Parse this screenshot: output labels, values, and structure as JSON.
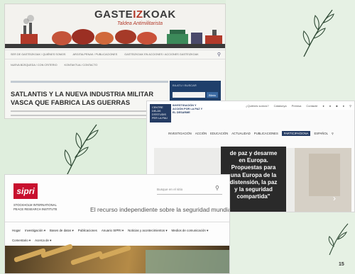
{
  "slide": {
    "page_number": "15",
    "colors": {
      "background": "#dfeedd",
      "leaf": "#2f4a35"
    },
    "decorations": [
      "leaf-icon",
      "leaf-icon",
      "leaf-icon"
    ]
  },
  "shot1": {
    "logo_part1": "GASTE",
    "logo_part2": "IZ",
    "logo_part3": "KOAK",
    "subtitle": "Taldea Antimilitarista",
    "nav_row1": [
      "Ser de Gasteizkoak / Quiénes somos",
      "Argitalpenak / Publicaciones",
      "Gasteizkoak en Acciones / Acciones Gasteizkoak"
    ],
    "nav_row2": [
      "Nueva búsqueda / Con criterio",
      "Kontaktua / Contacto"
    ],
    "title": "SATLANTIS Y LA NUEVA INDUSTRIA MILITAR VASCA QUE FABRICA LAS GUERRAS",
    "sidebar_label": "Bilatu / Buscar",
    "sidebar_button": "Bilatu",
    "colors": {
      "accent": "#b23a2a",
      "sidebar": "#1f3f6b"
    }
  },
  "shot2": {
    "topbar": [
      "¿Quiénes somos?",
      "Catalunya",
      "Premsa",
      "Contacte"
    ],
    "logo_box": "Centre Delàs d'Estudis per la Pau",
    "logo_text": "Investigación y acción por la paz y el desarme",
    "nav": [
      "Investigación",
      "Acción",
      "Educación",
      "Actualidad",
      "Publicaciones",
      "Participa/dona",
      "Español"
    ],
    "nav_active_index": 5,
    "quote_lines": [
      "de paz y desarme",
      "en Europa.",
      "Propuestas para",
      "una Europa de la",
      "distensión, la paz",
      "y la seguridad",
      "compartida\""
    ],
    "colors": {
      "brand": "#243b63",
      "quote_bg": "#2a2a2a"
    }
  },
  "shot3": {
    "logo": "sipri",
    "org_line1": "Stockholm International",
    "org_line2": "Peace Research Institute",
    "search_placeholder": "Busque en el sitio",
    "tagline": "El recurso independiente sobre la seguridad mundial",
    "nav_row1": [
      "Hogar",
      "Investigación",
      "Bases de datos",
      "Publicaciones",
      "Anuario SIPRI",
      "Noticias y acontecimientos",
      "Medios de comunicación"
    ],
    "nav_row2": [
      "Comentario",
      "Acerca de"
    ],
    "colors": {
      "logo": "#c8102e"
    }
  }
}
